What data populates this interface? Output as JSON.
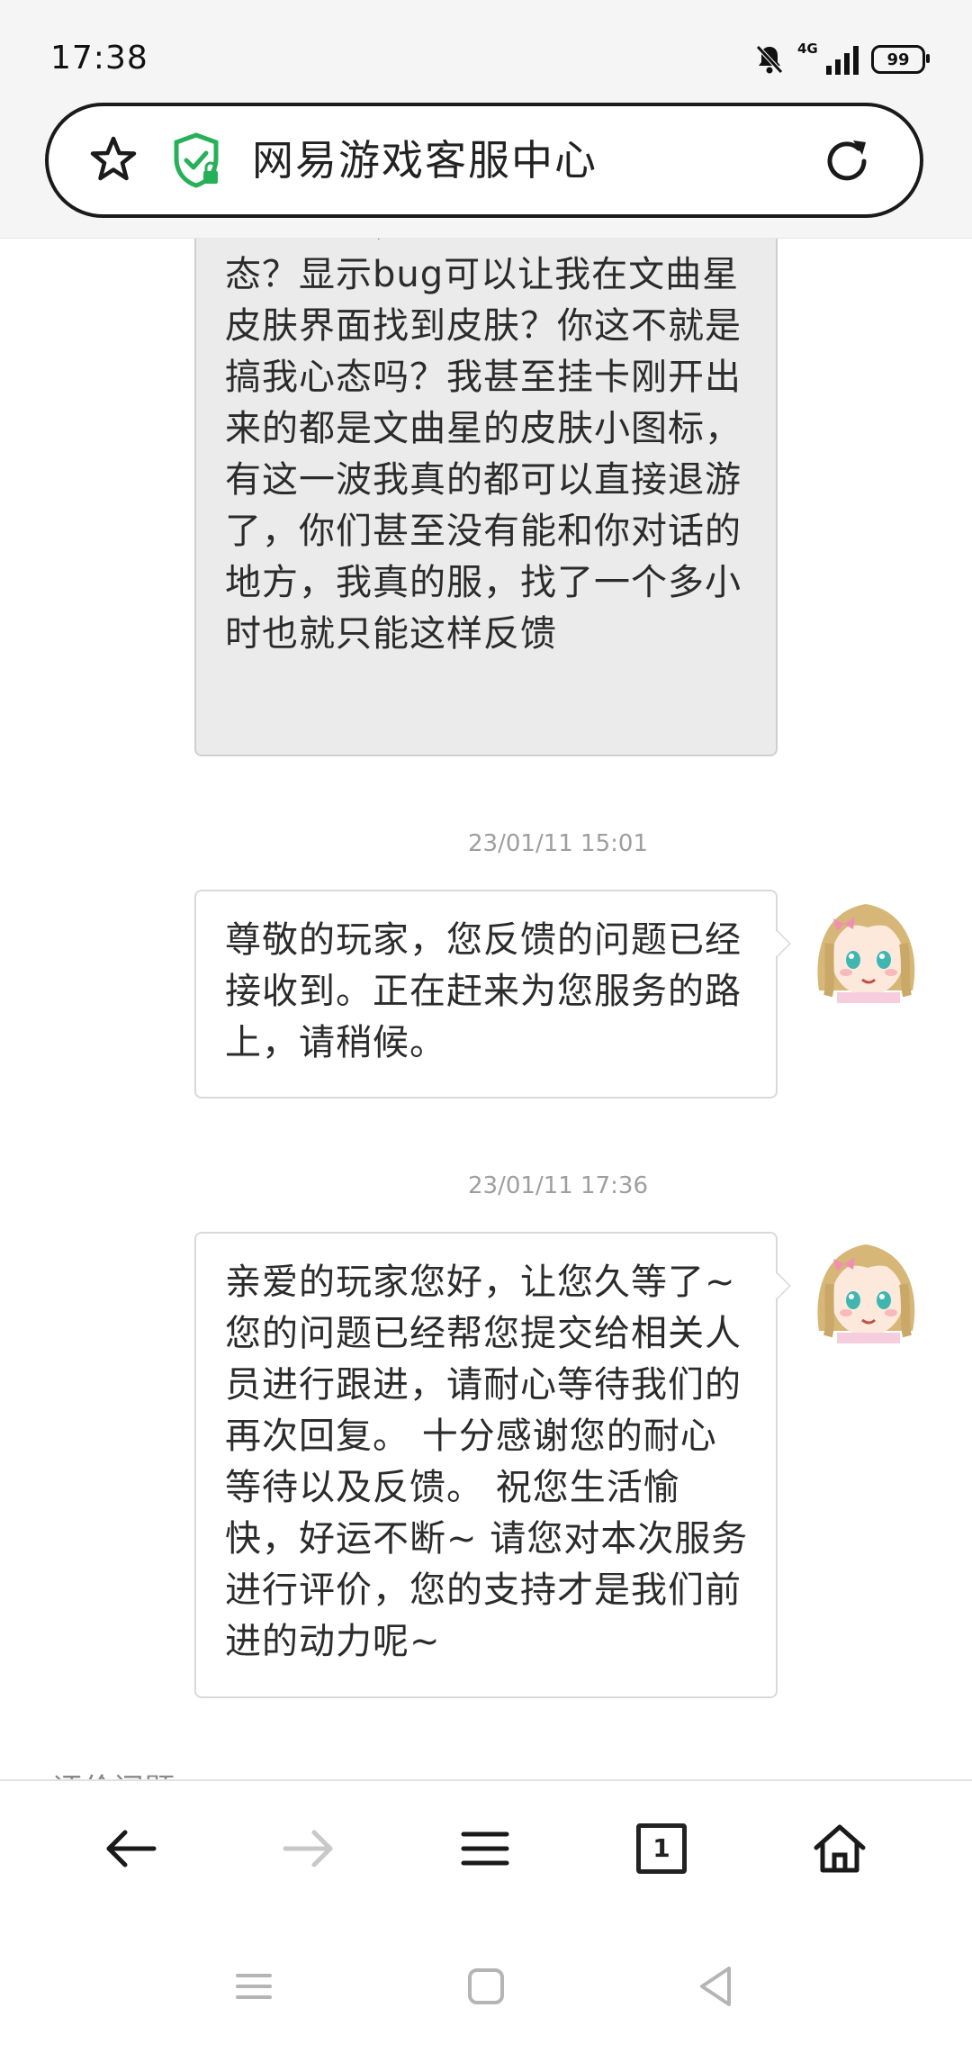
{
  "status_bar": {
    "time": "17:38",
    "network": "4G",
    "battery": "99"
  },
  "address_bar": {
    "title": "网易游戏客服中心",
    "star_icon": "star-icon",
    "secure_icon": "shield-check-icon",
    "reload_icon": "reload-icon"
  },
  "messages": [
    {
      "sender": "user",
      "text": "一个奖励，什么意思？搞我心态？显示bug可以让我在文曲星皮肤界面找到皮肤？你这不就是搞我心态吗？我甚至挂卡刚开出来的都是文曲星的皮肤小图标，有这一波我真的都可以直接退游了，你们甚至没有能和你对话的地方，我真的服，找了一个多小时也就只能这样反馈"
    },
    {
      "sender": "agent",
      "timestamp": "23/01/11 15:01",
      "text": "尊敬的玩家，您反馈的问题已经接收到。正在赶来为您服务的路上，请稍候。"
    },
    {
      "sender": "agent",
      "timestamp": "23/01/11 17:36",
      "text": "亲爱的玩家您好，让您久等了~ 您的问题已经帮您提交给相关人员进行跟进，请耐心等待我们的再次回复。 十分感谢您的耐心等待以及反馈。 祝您生活愉快，好运不断~ 请您对本次服务进行评价，您的支持才是我们前进的动力呢~"
    }
  ],
  "section_label": "评价问题",
  "toolbar": {
    "back": "arrow-left-icon",
    "forward": "arrow-right-icon",
    "menu": "menu-icon",
    "tabs_count": "1",
    "home": "home-icon"
  },
  "colors": {
    "secure_green": "#27b05a",
    "user_bubble": "#ebebeb",
    "border": "#d9d9d9"
  }
}
